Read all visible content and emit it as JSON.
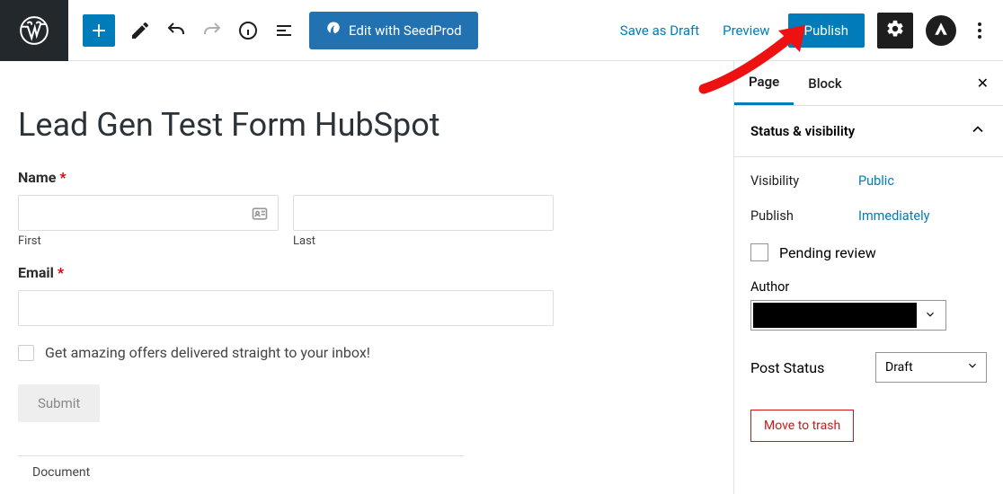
{
  "toolbar": {
    "seedprod_label": "Edit with SeedProd",
    "save_draft": "Save as Draft",
    "preview": "Preview",
    "publish": "Publish"
  },
  "editor": {
    "page_title": "Lead Gen Test Form HubSpot",
    "name_label": "Name",
    "first_label": "First",
    "last_label": "Last",
    "email_label": "Email",
    "offers_label": "Get amazing offers delivered straight to your inbox!",
    "submit_label": "Submit"
  },
  "sidebar": {
    "tabs": {
      "page": "Page",
      "block": "Block"
    },
    "panel_status": "Status & visibility",
    "visibility_label": "Visibility",
    "visibility_value": "Public",
    "publish_label": "Publish",
    "publish_value": "Immediately",
    "pending_label": "Pending review",
    "author_label": "Author",
    "poststatus_label": "Post Status",
    "poststatus_value": "Draft",
    "trash_label": "Move to trash"
  },
  "footer": {
    "breadcrumb": "Document"
  }
}
